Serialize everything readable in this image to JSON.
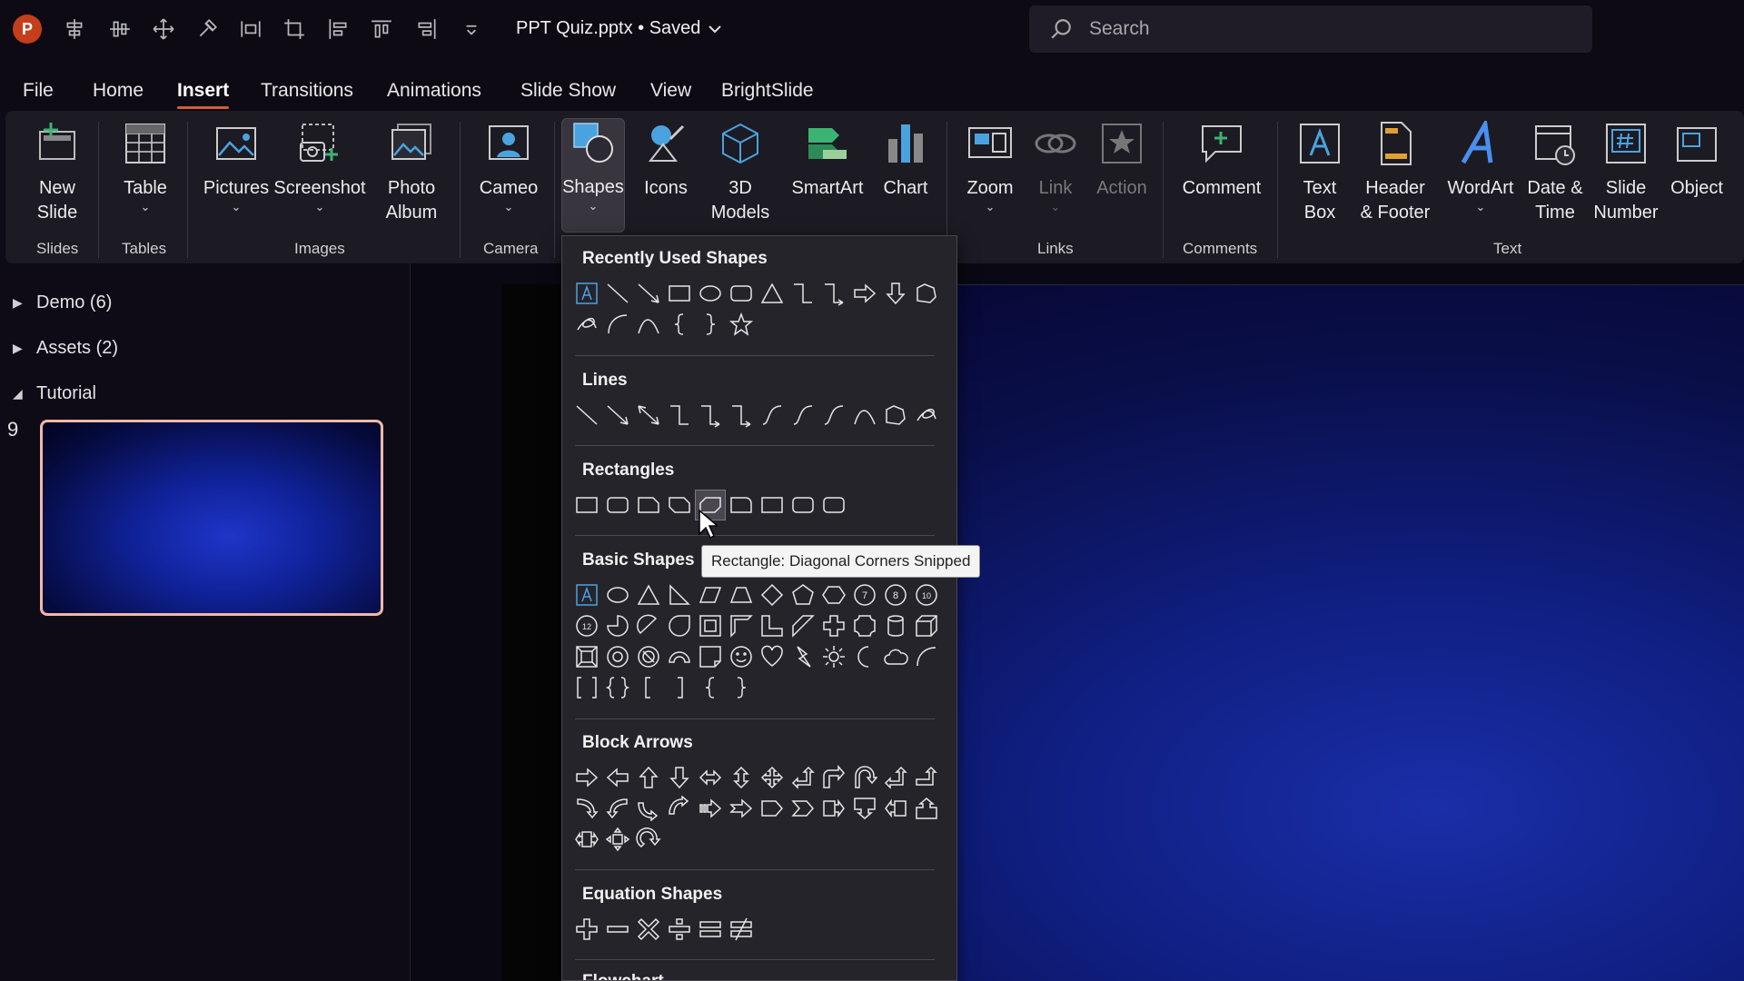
{
  "app": {
    "logo_letter": "P"
  },
  "title": {
    "doc_name": "PPT Quiz.pptx • Saved"
  },
  "search": {
    "placeholder": "Search"
  },
  "menu": {
    "tabs": [
      "File",
      "Home",
      "Insert",
      "Transitions",
      "Animations",
      "Slide Show",
      "View",
      "BrightSlide"
    ],
    "active": "Insert"
  },
  "ribbon": {
    "buttons": {
      "new_slide": "New\nSlide",
      "table": "Table",
      "pictures": "Pictures",
      "screenshot": "Screenshot",
      "photo_album": "Photo\nAlbum",
      "cameo": "Cameo",
      "shapes": "Shapes",
      "icons": "Icons",
      "models_3d": "3D\nModels",
      "smartart": "SmartArt",
      "chart": "Chart",
      "zoom": "Zoom",
      "link": "Link",
      "action": "Action",
      "comment": "Comment",
      "text_box": "Text\nBox",
      "header_footer": "Header\n& Footer",
      "wordart": "WordArt",
      "date_time": "Date &\nTime",
      "slide_number": "Slide\nNumber",
      "object": "Object"
    },
    "groups": {
      "slides": "Slides",
      "tables": "Tables",
      "images": "Images",
      "camera": "Camera",
      "links": "Links",
      "comments": "Comments",
      "text": "Text"
    },
    "caret": "⌄"
  },
  "left_panel": {
    "sections": [
      {
        "label": "Demo (6)",
        "arrow": "▶"
      },
      {
        "label": "Assets (2)",
        "arrow": "▶"
      },
      {
        "label": "Tutorial",
        "arrow": "◢"
      }
    ],
    "slide_number": "9"
  },
  "shapes_menu": {
    "categories": {
      "recent": "Recently Used Shapes",
      "lines": "Lines",
      "rectangles": "Rectangles",
      "basic": "Basic Shapes",
      "block_arrows": "Block Arrows",
      "equation": "Equation Shapes",
      "flowchart": "Flowchart"
    },
    "tooltip": "Rectangle: Diagonal Corners Snipped"
  },
  "colors": {
    "accent": "#d35b37",
    "app_red": "#c43e1c",
    "ribbon_bg": "#1c1a22"
  }
}
